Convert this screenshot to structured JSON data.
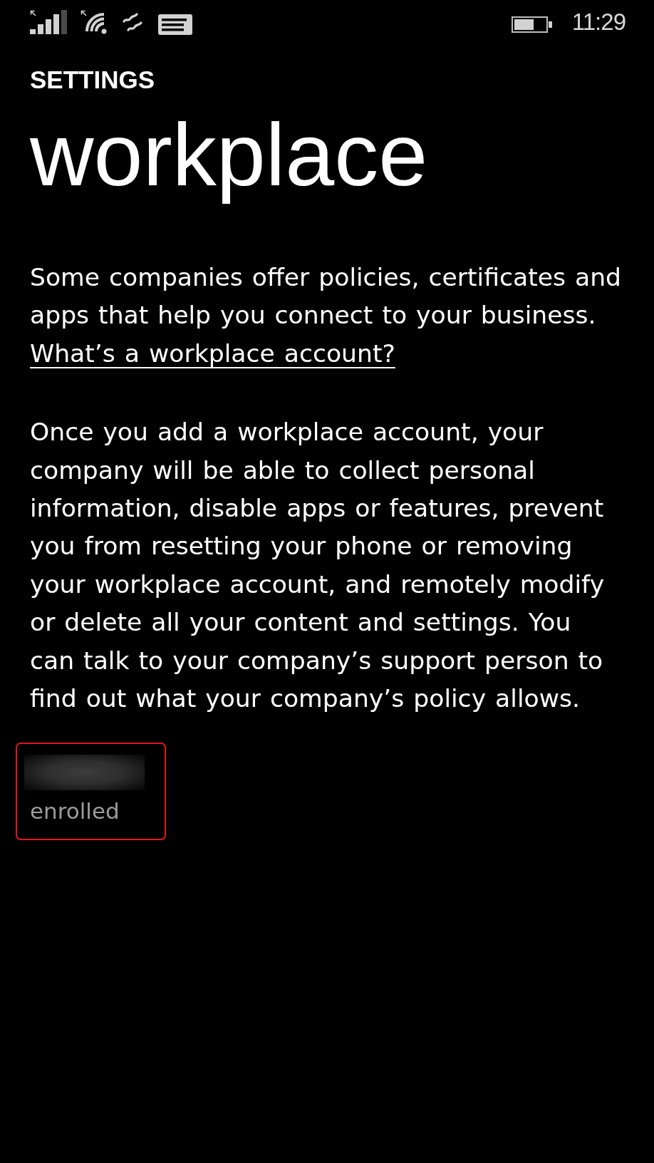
{
  "status_bar": {
    "time": "11:29"
  },
  "header": {
    "app_title": "SETTINGS",
    "page_title": "workplace"
  },
  "intro": {
    "text": "Some companies offer policies, certificates and apps that help you connect to your business.",
    "link": "What’s a workplace account?"
  },
  "notice": "Once you add a workplace account, your company will be able to collect personal information, disable apps or features, prevent you from resetting your phone or removing your workplace account, and remotely modify or delete all your content and settings. You can talk to your company’s support person to find out what your company’s policy allows.",
  "accounts": [
    {
      "status": "enrolled",
      "highlighted": true
    }
  ]
}
